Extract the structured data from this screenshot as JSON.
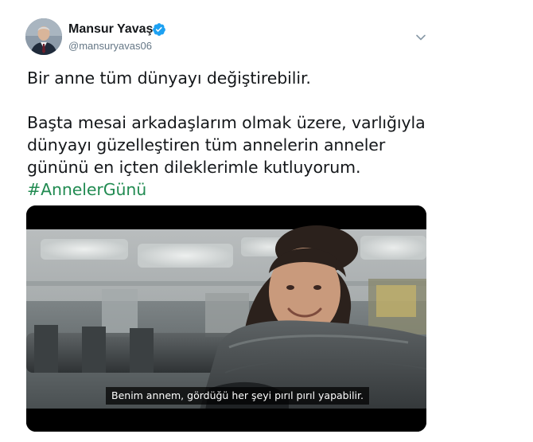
{
  "author": {
    "name": "Mansur Yavaş",
    "handle": "@mansuryavas06",
    "verified": true
  },
  "tweet": {
    "line1": "Bir anne tüm dünyayı değiştirebilir.",
    "body": "Başta mesai arkadaşlarım olmak üzere, varlığıyla dünyayı güzelleştiren tüm annelerin anneler gününü en içten dileklerimle kutluyorum. ",
    "hashtag": "#AnnelerGünü"
  },
  "video": {
    "subtitle": "Benim annem, gördüğü her şeyi pırıl pırıl yapabilir."
  },
  "colors": {
    "text": "#14171a",
    "secondary": "#657786",
    "hashtag": "#228b52",
    "verified": "#1da1f2"
  },
  "icons": {
    "verified": "verified-badge-icon",
    "menu": "chevron-down-icon"
  }
}
